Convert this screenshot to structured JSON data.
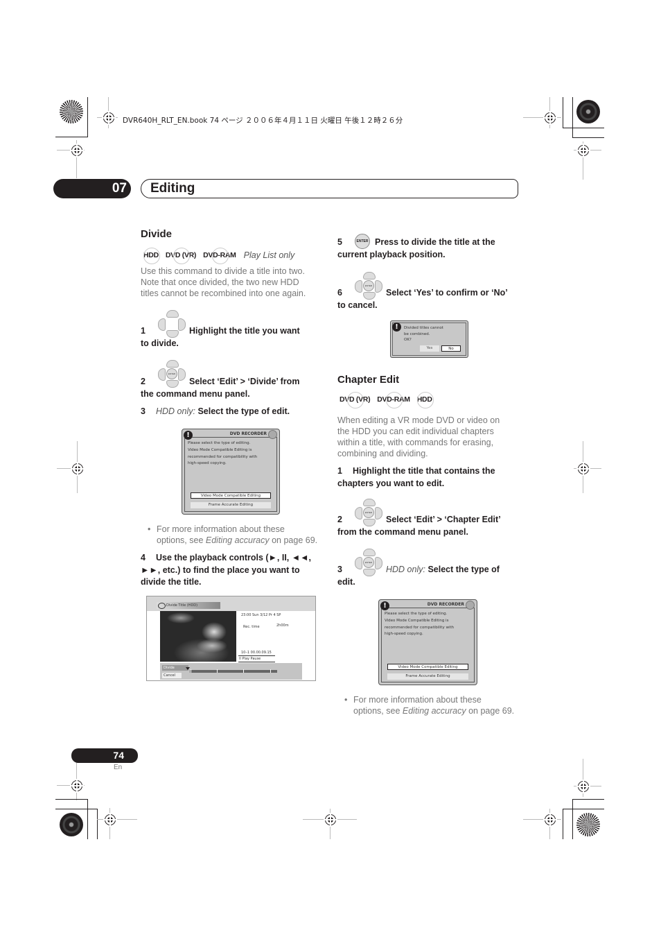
{
  "print_header": "DVR640H_RLT_EN.book  74 ページ  ２００６年４月１１日  火曜日  午後１２時２６分",
  "chapter": {
    "number": "07",
    "title": "Editing"
  },
  "divide": {
    "heading": "Divide",
    "badges": [
      "HDD",
      "DVD (VR)",
      "DVD-RAM"
    ],
    "badge_note": "Play List only",
    "intro": [
      "Use this command to divide a title into two.",
      "Note that once divided, the two new HDD",
      "titles cannot be recombined into one again."
    ],
    "steps": [
      {
        "num": "1",
        "icon": "remote-dpad-icon",
        "lines": [
          "Highlight the title you want",
          "to divide."
        ]
      },
      {
        "num": "2",
        "icon": "remote-dpad-enter-icon",
        "lines": [
          "Select ‘Edit’ > ‘Divide’ from",
          "the command menu panel."
        ]
      },
      {
        "num": "3",
        "prefix": "HDD only:",
        "text": "Select the type of edit."
      },
      {
        "num": "4",
        "lines": [
          "Use the playback controls (►, II, ◄◄,",
          "►►, etc.) to find the place you want to",
          "divide the title."
        ]
      },
      {
        "num": "5",
        "icon": "enter-button-icon",
        "lines": [
          "Press to divide the title at the",
          "current playback position."
        ]
      },
      {
        "num": "6",
        "icon": "remote-dpad-enter-icon",
        "lines": [
          "Select ‘Yes’ to confirm or ‘No’",
          "to cancel."
        ]
      }
    ],
    "bullet": {
      "pre": "For more information about these",
      "pre2": "options, see ",
      "link": "Editing accuracy",
      "post": " on page 69."
    }
  },
  "edit_type_dialog": {
    "title": "DVD RECORDER",
    "message": [
      "Please select the type of editing.",
      "Video Mode Compatible Editing is",
      "recommended for compatibility with",
      "high-speed copying."
    ],
    "options": [
      {
        "label": "Video Mode Compatible Editing",
        "selected": true
      },
      {
        "label": "Frame Accurate Editing",
        "selected": false
      }
    ]
  },
  "divide_screen": {
    "title": "Divide Title  (HDD)",
    "info_line": "23:00  Sun   3/12  Pr 4    SP",
    "rec_time_label": "Rec. time",
    "rec_time_value": "2h00m",
    "position": "10–1    00.00.09.15",
    "status": "II Play Pause",
    "buttons": [
      "Divide",
      "Cancel"
    ]
  },
  "confirm_dialog": {
    "message": [
      "Divided titles cannot",
      "be combined.",
      "OK?"
    ],
    "yes": "Yes",
    "no": "No"
  },
  "chapter_edit": {
    "heading": "Chapter Edit",
    "badges": [
      "DVD (VR)",
      "DVD-RAM",
      "HDD"
    ],
    "intro": [
      "When editing a VR mode DVD or video on",
      "the HDD you can edit individual chapters",
      "within a title, with commands for erasing,",
      "combining and dividing."
    ],
    "steps": [
      {
        "num": "1",
        "lines": [
          "Highlight the title that contains the",
          "chapters you want to edit."
        ]
      },
      {
        "num": "2",
        "icon": "remote-dpad-enter-icon",
        "lines": [
          "Select ‘Edit’ > ‘Chapter Edit’",
          "from the command menu panel."
        ]
      },
      {
        "num": "3",
        "icon": "remote-dpad-enter-icon",
        "prefix": "HDD only:",
        "lines": [
          "Select the type of",
          "edit."
        ]
      }
    ],
    "bullet": {
      "pre": "For more information about these",
      "pre2": "options, see ",
      "link": "Editing accuracy",
      "post": " on page 69."
    }
  },
  "footer": {
    "page_number": "74",
    "language": "En"
  }
}
